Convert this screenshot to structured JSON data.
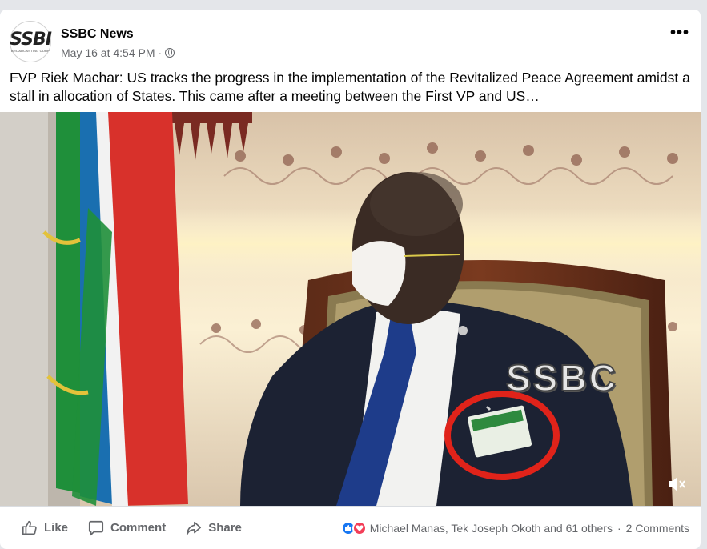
{
  "post": {
    "page_name": "SSBC News",
    "avatar_text": "SSBI",
    "avatar_subtext": "BROADCASTING CORP",
    "timestamp": "May 16 at 4:54 PM",
    "dot": "·",
    "caption": "FVP Riek Machar: US tracks the progress in the implementation of the Revitalized Peace Agreement amidst a stall in allocation of States. This came after a meeting between the First VP and US…",
    "more_icon": "more-options-icon"
  },
  "video": {
    "watermark": "SSBC",
    "mute_icon": "muted-speaker-icon",
    "highlight_color": "#e0231a"
  },
  "actions": {
    "like_label": "Like",
    "comment_label": "Comment",
    "share_label": "Share"
  },
  "reactions": {
    "names_text": "Michael Manas, Tek Joseph Okoth and 61 others",
    "dot": "·",
    "comments_text": "2 Comments",
    "like_color": "#1877f2",
    "love_color": "#f33e58"
  }
}
